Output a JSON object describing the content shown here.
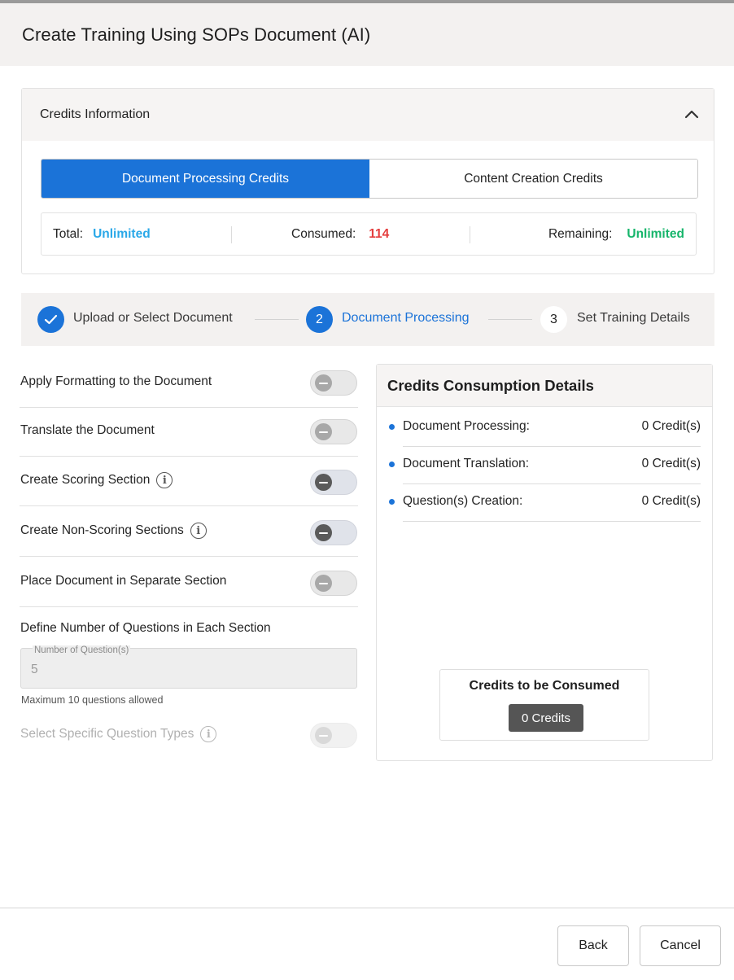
{
  "dialog": {
    "title": "Create Training Using SOPs Document (AI)"
  },
  "credits_info": {
    "title": "Credits Information",
    "tabs": [
      {
        "label": "Document Processing Credits",
        "active": true
      },
      {
        "label": "Content Creation Credits",
        "active": false
      }
    ],
    "total_label": "Total:",
    "total_value": "Unlimited",
    "consumed_label": "Consumed:",
    "consumed_value": "114",
    "remaining_label": "Remaining:",
    "remaining_value": "Unlimited",
    "colors": {
      "accent": "#1b73d8",
      "total": "#2aa8e8",
      "consumed": "#e43d3d",
      "remaining": "#16b56b"
    }
  },
  "stepper": {
    "steps": [
      {
        "label": "Upload or Select Document",
        "state": "completed",
        "icon": "check-icon"
      },
      {
        "number": "2",
        "label": "Document Processing",
        "state": "active"
      },
      {
        "number": "3",
        "label": "Set Training Details",
        "state": "pending"
      }
    ]
  },
  "options": [
    {
      "label": "Apply Formatting to the Document",
      "info": false,
      "on": false
    },
    {
      "label": "Translate the Document",
      "info": false,
      "on": false
    },
    {
      "label": "Create Scoring Section",
      "info": true,
      "on": false
    },
    {
      "label": "Create Non-Scoring Sections",
      "info": true,
      "on": false
    },
    {
      "label": "Place Document in Separate Section",
      "info": false,
      "on": false
    }
  ],
  "questions": {
    "title": "Define Number of Questions in Each Section",
    "field_label": "Number of Question(s)",
    "field_value": "5",
    "hint": "Maximum 10 questions allowed",
    "select_types_label": "Select Specific Question Types"
  },
  "consumption": {
    "title": "Credits Consumption Details",
    "rows": [
      {
        "label": "Document Processing:",
        "value": "0 Credit(s)"
      },
      {
        "label": "Document Translation:",
        "value": "0 Credit(s)"
      },
      {
        "label": "Question(s) Creation:",
        "value": "0 Credit(s)"
      }
    ],
    "to_be_consumed_title": "Credits to be Consumed",
    "to_be_consumed_value": "0 Credits"
  },
  "footer": {
    "back_label": "Back",
    "cancel_label": "Cancel"
  }
}
